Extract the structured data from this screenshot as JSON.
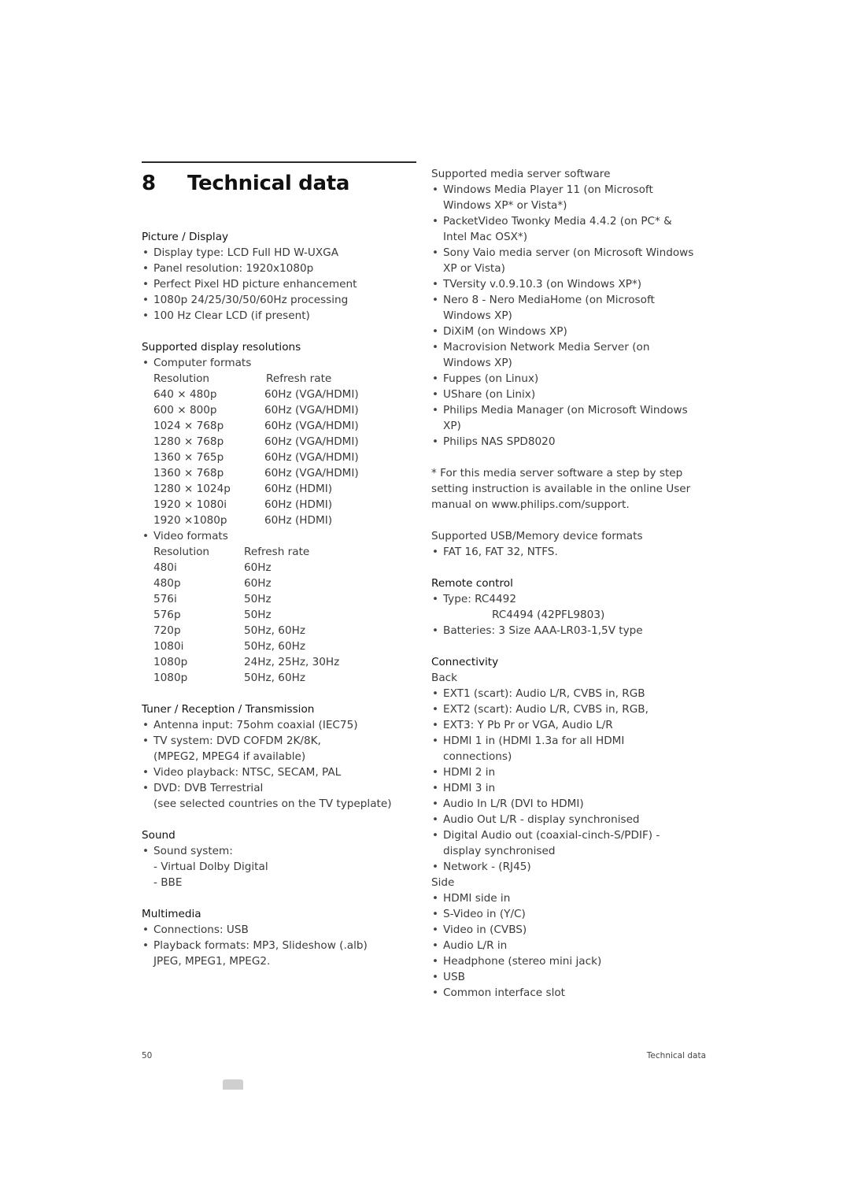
{
  "chapter": {
    "number": "8",
    "title": "Technical data"
  },
  "left": {
    "picture": {
      "heading": "Picture / Display",
      "items": [
        "Display type: LCD Full HD W-UXGA",
        "Panel resolution: 1920x1080p",
        "Perfect Pixel HD picture enhancement",
        "1080p 24/25/30/50/60Hz processing",
        "100 Hz Clear LCD (if present)"
      ]
    },
    "resolutions": {
      "heading": "Supported display resolutions",
      "computer_label": "Computer formats",
      "computer_header": [
        "Resolution",
        "Refresh rate"
      ],
      "computer_rows": [
        [
          "640 × 480p",
          "60Hz (VGA/HDMI)"
        ],
        [
          "600 × 800p",
          "60Hz (VGA/HDMI)"
        ],
        [
          "1024 × 768p",
          "60Hz (VGA/HDMI)"
        ],
        [
          "1280 × 768p",
          "60Hz (VGA/HDMI)"
        ],
        [
          "1360 × 765p",
          "60Hz (VGA/HDMI)"
        ],
        [
          "1360 × 768p",
          "60Hz (VGA/HDMI)"
        ],
        [
          "1280 × 1024p",
          "60Hz (HDMI)"
        ],
        [
          "1920 × 1080i",
          "60Hz (HDMI)"
        ],
        [
          "1920 ×1080p",
          "60Hz (HDMI)"
        ]
      ],
      "video_label": "Video formats",
      "video_header": [
        "Resolution",
        "Refresh rate"
      ],
      "video_rows": [
        [
          "480i",
          "60Hz"
        ],
        [
          "480p",
          "60Hz"
        ],
        [
          "576i",
          "50Hz"
        ],
        [
          "576p",
          "50Hz"
        ],
        [
          "720p",
          "50Hz, 60Hz"
        ],
        [
          "1080i",
          "50Hz, 60Hz"
        ],
        [
          "1080p",
          "24Hz, 25Hz, 30Hz"
        ],
        [
          "1080p",
          "50Hz, 60Hz"
        ]
      ]
    },
    "tuner": {
      "heading": "Tuner / Reception / Transmission",
      "items": [
        [
          "Antenna input: 75ohm coaxial (IEC75)"
        ],
        [
          "TV system: DVD COFDM 2K/8K,",
          "(MPEG2, MPEG4 if available)"
        ],
        [
          "Video playback: NTSC, SECAM, PAL"
        ],
        [
          "DVD: DVB Terrestrial",
          "(see selected countries on the TV typeplate)"
        ]
      ]
    },
    "sound": {
      "heading": "Sound",
      "item": "Sound system:",
      "sub": [
        "- Virtual Dolby Digital",
        "- BBE"
      ]
    },
    "multimedia": {
      "heading": "Multimedia",
      "items": [
        [
          "Connections: USB"
        ],
        [
          "Playback formats: MP3, Slideshow (.alb)",
          "JPEG, MPEG1, MPEG2."
        ]
      ]
    }
  },
  "right": {
    "media_server": {
      "heading": "Supported media server software",
      "items": [
        [
          "Windows Media Player 11 (on Microsoft",
          "Windows XP* or Vista*)"
        ],
        [
          "PacketVideo Twonky Media 4.4.2 (on PC* &",
          "Intel Mac OSX*)"
        ],
        [
          "Sony Vaio media server (on Microsoft Windows",
          "XP or Vista)"
        ],
        [
          "TVersity v.0.9.10.3 (on Windows XP*)"
        ],
        [
          "Nero 8 - Nero MediaHome (on Microsoft",
          "Windows XP)"
        ],
        [
          "DiXiM (on Windows XP)"
        ],
        [
          "Macrovision Network Media Server (on",
          "Windows XP)"
        ],
        [
          "Fuppes (on Linux)"
        ],
        [
          "UShare (on Linix)"
        ],
        [
          "Philips Media Manager (on Microsoft Windows",
          "XP)"
        ],
        [
          "Philips NAS SPD8020"
        ]
      ]
    },
    "note": [
      "* For this media server software a step by step",
      "setting instruction is available in the online User",
      "manual on www.philips.com/support."
    ],
    "usb": {
      "heading": "Supported USB/Memory device formats",
      "items": [
        "FAT 16, FAT 32, NTFS."
      ]
    },
    "remote": {
      "heading": "Remote control",
      "type": "Type: RC4492",
      "type2": "RC4494 (42PFL9803)",
      "batteries": "Batteries: 3 Size AAA-LR03-1,5V type"
    },
    "connectivity": {
      "heading": "Connectivity",
      "back_label": "Back",
      "back_items": [
        [
          "EXT1 (scart): Audio L/R, CVBS in, RGB"
        ],
        [
          "EXT2 (scart): Audio L/R, CVBS in, RGB,"
        ],
        [
          "EXT3: Y Pb Pr or VGA, Audio L/R"
        ],
        [
          "HDMI 1 in (HDMI 1.3a for all HDMI",
          "connections)"
        ],
        [
          "HDMI 2 in"
        ],
        [
          "HDMI 3 in"
        ],
        [
          "Audio In L/R (DVI to HDMI)"
        ],
        [
          "Audio Out L/R - display synchronised"
        ],
        [
          "Digital Audio out (coaxial-cinch-S/PDIF) -",
          "display synchronised"
        ],
        [
          "Network - (RJ45)"
        ]
      ],
      "side_label": "Side",
      "side_items": [
        "HDMI side in",
        "S-Video in (Y/C)",
        "Video in (CVBS)",
        "Audio L/R in",
        "Headphone (stereo mini jack)",
        "USB",
        "Common interface slot"
      ]
    }
  },
  "footer": {
    "page_number": "50",
    "section": "Technical data"
  },
  "bullet": "•"
}
